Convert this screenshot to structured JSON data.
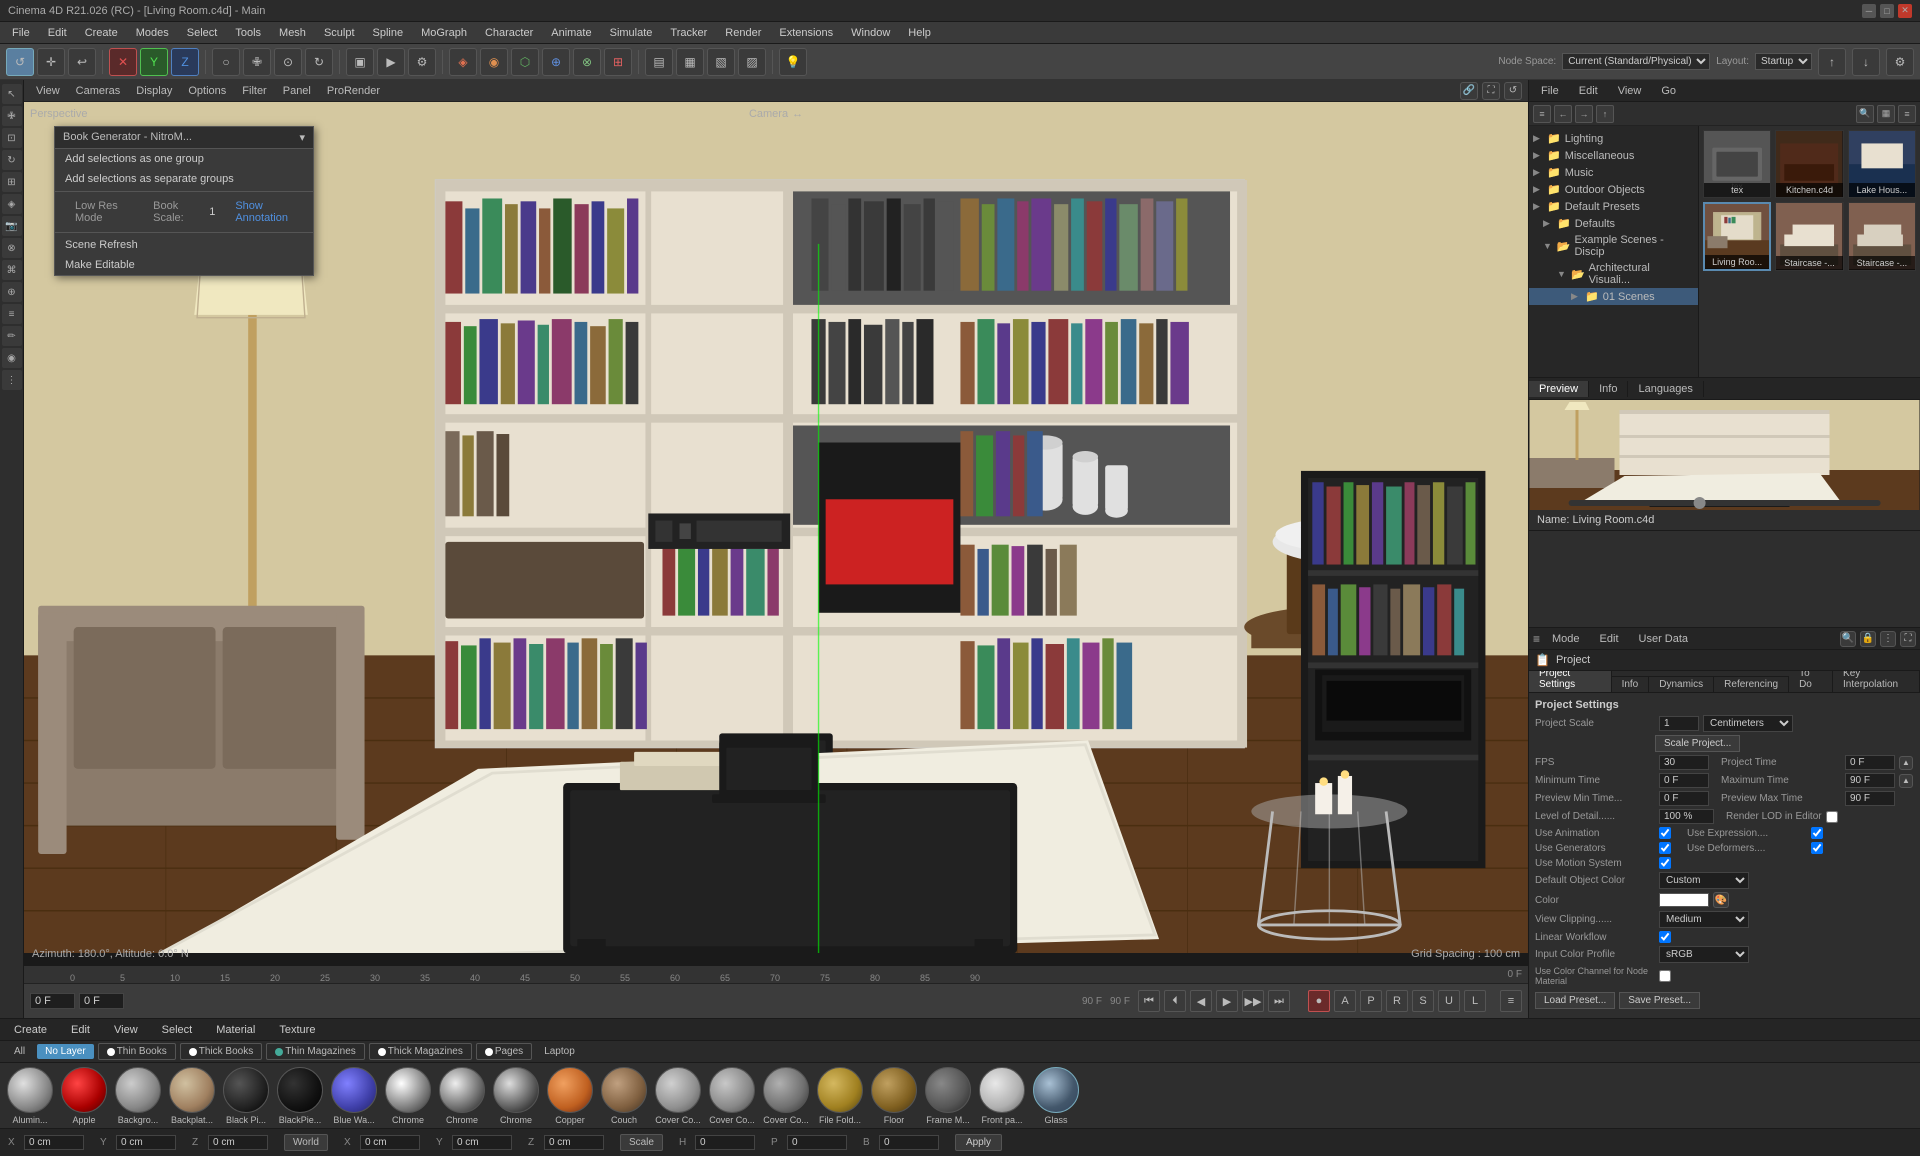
{
  "app": {
    "title": "Cinema 4D R21.026 (RC) - [Living Room.c4d] - Main",
    "version": "R21.026"
  },
  "titlebar": {
    "title": "Cinema 4D R21.026 (RC) - [Living Room.c4d] - Main",
    "minimize": "─",
    "maximize": "□",
    "close": "✕"
  },
  "menubar": {
    "items": [
      "File",
      "Edit",
      "Create",
      "Modes",
      "Select",
      "Tools",
      "Mesh",
      "Sculpt",
      "Spline",
      "MoGraph",
      "Character",
      "Animate",
      "Simulate",
      "Tracker",
      "Render",
      "Extensions",
      "Window",
      "Help"
    ]
  },
  "viewport": {
    "label": "Perspective",
    "camera": "Camera",
    "grid_spacing": "Grid Spacing : 100 cm",
    "coord_label": "Azimuth: 180.0°, Altitude: 0.0° N"
  },
  "viewport_menus": [
    "View",
    "Cameras",
    "Display",
    "Options",
    "Filter",
    "Panel",
    "ProRender"
  ],
  "context_menu": {
    "title": "Book Generator - NitroM...",
    "items": [
      "Add selections as one group",
      "Add selections as separate groups"
    ],
    "low_res_mode": "Low Res Mode",
    "book_scale_label": "Book Scale:",
    "book_scale_value": "1",
    "show_annotation": "Show Annotation",
    "scene_refresh": "Scene Refresh",
    "make_editable": "Make Editable"
  },
  "timeline": {
    "current_frame": "0 F",
    "frame_start": "0 F",
    "frame_end": "90 F",
    "fps": "90 F",
    "marks": [
      "0",
      "5",
      "10",
      "15",
      "20",
      "25",
      "30",
      "35",
      "40",
      "45",
      "50",
      "55",
      "60",
      "65",
      "70",
      "75",
      "80",
      "85",
      "90"
    ],
    "transport_btns": [
      "⏮",
      "⏴",
      "◀",
      "▶",
      "▶▶",
      "⏭"
    ]
  },
  "node_space": {
    "label": "Node Space:",
    "value": "Current (Standard/Physical)"
  },
  "layout": {
    "label": "Layout:",
    "value": "Startup"
  },
  "asset_browser": {
    "header_items": [
      "File",
      "Edit",
      "View",
      "Go"
    ],
    "toolbar_btns": [
      "≡",
      "←",
      "→",
      "↑"
    ],
    "tree_items": [
      {
        "label": "Lighting",
        "indent": 2,
        "expanded": false,
        "icon": "📁"
      },
      {
        "label": "Miscellaneous",
        "indent": 2,
        "expanded": false,
        "icon": "📁"
      },
      {
        "label": "Music",
        "indent": 2,
        "expanded": false,
        "icon": "📁"
      },
      {
        "label": "Outdoor Objects",
        "indent": 2,
        "expanded": false,
        "icon": "📁"
      },
      {
        "label": "Default Presets",
        "indent": 1,
        "expanded": false,
        "icon": "📁"
      },
      {
        "label": "Defaults",
        "indent": 2,
        "expanded": false,
        "icon": "📁"
      },
      {
        "label": "Example Scenes - Discip",
        "indent": 2,
        "expanded": true,
        "icon": "📁"
      },
      {
        "label": "Architectural Visuali...",
        "indent": 3,
        "expanded": true,
        "icon": "📁"
      },
      {
        "label": "01 Scenes",
        "indent": 4,
        "expanded": false,
        "icon": "📁"
      }
    ],
    "thumbnails": [
      {
        "label": "tex",
        "color": "#888"
      },
      {
        "label": "Kitchen.c4d",
        "color": "#604030"
      },
      {
        "label": "Lake Hous...",
        "color": "#406080"
      },
      {
        "label": "Living Roo...",
        "color": "#705040",
        "selected": true
      },
      {
        "label": "Staircase -...",
        "color": "#806050"
      },
      {
        "label": "Staircase -...",
        "color": "#806050"
      }
    ]
  },
  "preview": {
    "tabs": [
      "Preview",
      "Info",
      "Languages"
    ],
    "name": "Name: Living Room.c4d"
  },
  "properties": {
    "mode_btns": [
      "Mode",
      "Edit",
      "User Data"
    ],
    "section": "Project",
    "tabs": [
      "Project Settings",
      "Info",
      "Dynamics",
      "Referencing",
      "To Do"
    ],
    "key_interpolation_tab": "Key Interpolation",
    "section_title": "Project Settings",
    "fields": [
      {
        "label": "Project Scale",
        "value": "1",
        "unit": "Centimeters"
      },
      {
        "button": "Scale Project..."
      },
      {
        "label": "FPS",
        "value": "30"
      },
      {
        "label": "Project Time",
        "value": "0 F"
      },
      {
        "label": "Minimum Time",
        "value": "0 F"
      },
      {
        "label": "Maximum Time",
        "value": "90 F"
      },
      {
        "label": "Preview Min Time...",
        "value": "0 F"
      },
      {
        "label": "Preview Max Time",
        "value": "90 F"
      },
      {
        "label": "Level of Detail......",
        "value": "100 %"
      },
      {
        "label": "Render LOD in Editor",
        "checkbox": false
      },
      {
        "label": "Use Animation",
        "checkbox": true
      },
      {
        "label": "Use Expression....",
        "checkbox": true
      },
      {
        "label": "Use Generators",
        "checkbox": true
      },
      {
        "label": "Use Deformers....",
        "checkbox": true
      },
      {
        "label": "Use Motion System",
        "checkbox": true
      },
      {
        "label": "Default Object Color",
        "dropdown": "Custom"
      },
      {
        "label": "Color",
        "color": "#ffffff"
      },
      {
        "label": "View Clipping......",
        "dropdown": "Medium"
      },
      {
        "label": "Linear Workflow",
        "checkbox": true
      },
      {
        "label": "Input Color Profile",
        "dropdown": "sRGB"
      },
      {
        "label": "Use Color Channel for Node Material",
        "checkbox": false
      }
    ],
    "footer_btns": [
      "Load Preset...",
      "Save Preset..."
    ]
  },
  "bottom_menu": {
    "items": [
      "Create",
      "Edit",
      "View",
      "Select",
      "Material",
      "Texture"
    ]
  },
  "material_tabs": [
    {
      "label": "All",
      "active": false
    },
    {
      "label": "No Layer",
      "active": true
    },
    {
      "label": "Thin Books",
      "active": false,
      "dot": "white"
    },
    {
      "label": "Thick Books",
      "active": false,
      "dot": "white"
    },
    {
      "label": "Thin Magazines",
      "active": false,
      "dot": "green"
    },
    {
      "label": "Thick Magazines",
      "active": false,
      "dot": "white"
    },
    {
      "label": "Pages",
      "active": false,
      "dot": "white"
    },
    {
      "label": "Laptop",
      "active": false
    }
  ],
  "materials": [
    {
      "name": "Alumin...",
      "class": "mat-aluminum"
    },
    {
      "name": "Apple",
      "class": "mat-apple"
    },
    {
      "name": "Backgro...",
      "class": "mat-background"
    },
    {
      "name": "Backplat...",
      "class": "mat-backplate"
    },
    {
      "name": "Black Pi...",
      "class": "mat-blackpie"
    },
    {
      "name": "BlackPie...",
      "class": "mat-blackpie2"
    },
    {
      "name": "Blue Wa...",
      "class": "mat-bluewa"
    },
    {
      "name": "Chrome",
      "class": "mat-chrome"
    },
    {
      "name": "Chrome",
      "class": "mat-chrome2"
    },
    {
      "name": "Chrome",
      "class": "mat-chrome3"
    },
    {
      "name": "Copper",
      "class": "mat-copper"
    },
    {
      "name": "Couch",
      "class": "mat-couch"
    },
    {
      "name": "Cover Co...",
      "class": "mat-covercc"
    },
    {
      "name": "Cover Co...",
      "class": "mat-covercc2"
    },
    {
      "name": "Cover Co...",
      "class": "mat-covercc3"
    },
    {
      "name": "File Fold...",
      "class": "mat-filefold"
    },
    {
      "name": "Floor",
      "class": "mat-floor"
    },
    {
      "name": "Frame M...",
      "class": "mat-framem"
    },
    {
      "name": "Front pa...",
      "class": "mat-frontpa"
    },
    {
      "name": "Glass",
      "class": "mat-glass"
    }
  ],
  "coordinates": {
    "x_pos": "0 cm",
    "y_pos": "0 cm",
    "z_pos": "0 cm",
    "x_size": "0 cm",
    "y_size": "0 cm",
    "z_size": "0 cm",
    "h": "0",
    "p": "0",
    "b": "0",
    "world_label": "World",
    "scale_label": "Scale",
    "apply_label": "Apply"
  }
}
